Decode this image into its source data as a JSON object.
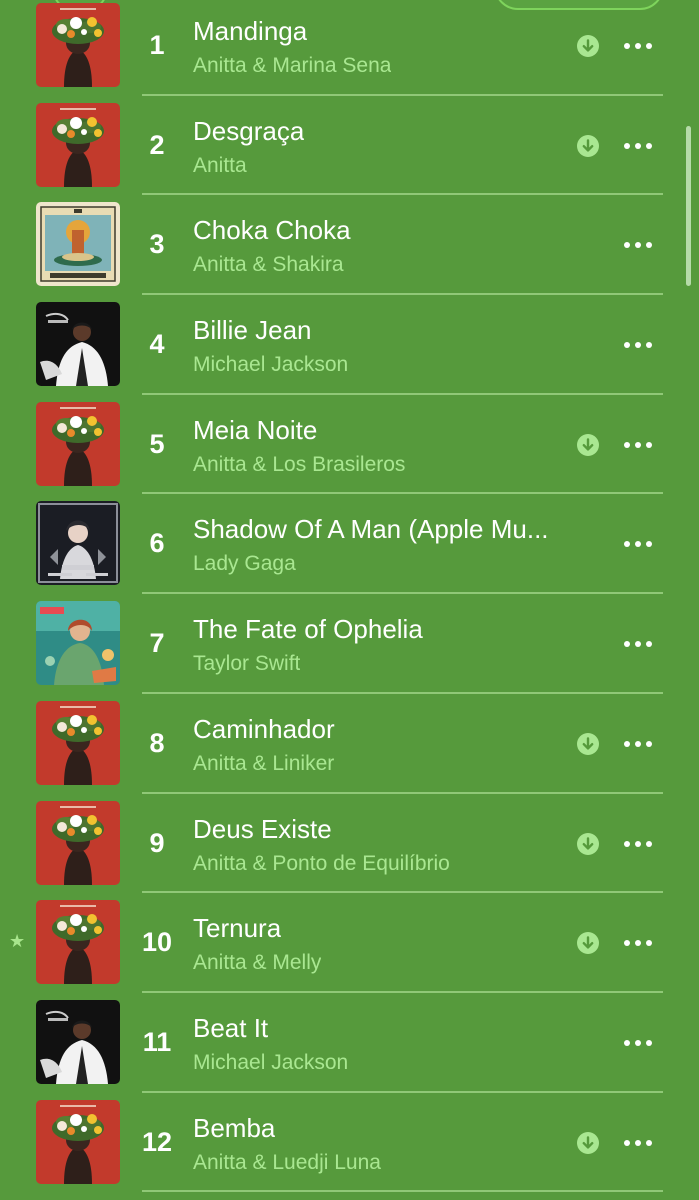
{
  "accent_color": "#a9e791",
  "background_color": "#569a3c",
  "tracks": [
    {
      "rank": "1",
      "title": "Mandinga",
      "artist": "Anitta & Marina Sena",
      "art": "anitta-funk-generation",
      "downloaded": true,
      "starred": false
    },
    {
      "rank": "2",
      "title": "Desgraça",
      "artist": "Anitta",
      "art": "anitta-funk-generation",
      "downloaded": true,
      "starred": false
    },
    {
      "rank": "3",
      "title": "Choka Choka",
      "artist": "Anitta & Shakira",
      "art": "choka-choka-tarot",
      "downloaded": false,
      "starred": false
    },
    {
      "rank": "4",
      "title": "Billie Jean",
      "artist": "Michael Jackson",
      "art": "thriller",
      "downloaded": false,
      "starred": false
    },
    {
      "rank": "5",
      "title": "Meia Noite",
      "artist": "Anitta & Los Brasileros",
      "art": "anitta-funk-generation",
      "downloaded": true,
      "starred": false
    },
    {
      "rank": "6",
      "title": "Shadow Of A Man (Apple Mu...",
      "artist": "Lady Gaga",
      "art": "harlequin",
      "downloaded": false,
      "starred": false
    },
    {
      "rank": "7",
      "title": "The Fate of Ophelia",
      "artist": "Taylor Swift",
      "art": "showgirl",
      "downloaded": false,
      "starred": false
    },
    {
      "rank": "8",
      "title": "Caminhador",
      "artist": "Anitta & Liniker",
      "art": "anitta-funk-generation",
      "downloaded": true,
      "starred": false
    },
    {
      "rank": "9",
      "title": "Deus Existe",
      "artist": "Anitta & Ponto de Equilíbrio",
      "art": "anitta-funk-generation",
      "downloaded": true,
      "starred": false
    },
    {
      "rank": "10",
      "title": "Ternura",
      "artist": "Anitta & Melly",
      "art": "anitta-funk-generation",
      "downloaded": true,
      "starred": true
    },
    {
      "rank": "11",
      "title": "Beat It",
      "artist": "Michael Jackson",
      "art": "thriller",
      "downloaded": false,
      "starred": false
    },
    {
      "rank": "12",
      "title": "Bemba",
      "artist": "Anitta & Luedji Luna",
      "art": "anitta-funk-generation",
      "downloaded": true,
      "starred": false
    }
  ],
  "icons": {
    "download": "download-arrow-circle-icon",
    "more": "more-ellipsis-icon",
    "star": "star-icon",
    "star_glyph": "★"
  }
}
